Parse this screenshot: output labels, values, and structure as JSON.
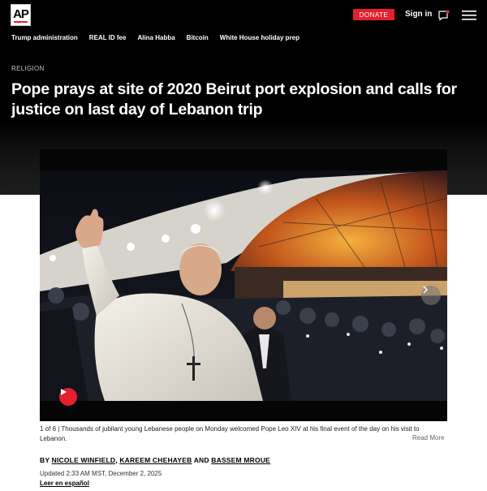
{
  "header": {
    "logo_text": "AP",
    "donate_label": "DONATE",
    "signin_label": "Sign in",
    "accent_color": "#e4202e",
    "icons": [
      "message-icon",
      "menu-icon"
    ]
  },
  "topnav": {
    "items": [
      "Trump administration",
      "REAL ID fee",
      "Alina Habba",
      "Bitcoin",
      "White House holiday prep"
    ]
  },
  "article": {
    "section": "RELIGION",
    "headline": "Pope prays at site of 2020 Beirut port explosion and calls for justice on last day of Lebanon trip"
  },
  "media": {
    "counter": "1 of 6 |",
    "caption": "Thousands of jubilant young Lebanese people on Monday welcomed Pope Leo XIV at his final event of the day on his visit to Lebanon.",
    "read_more": "Read More",
    "icons": [
      "play-icon",
      "chevron-right-icon"
    ]
  },
  "byline": {
    "prefix": "BY",
    "authors": [
      "NICOLE WINFIELD",
      "KAREEM CHEHAYEB",
      "BASSEM MROUE"
    ],
    "sep1": ",",
    "sep2": "AND",
    "updated": "Updated 2:33 AM MST, December 2, 2025",
    "spanish_link": "Leer en español"
  }
}
